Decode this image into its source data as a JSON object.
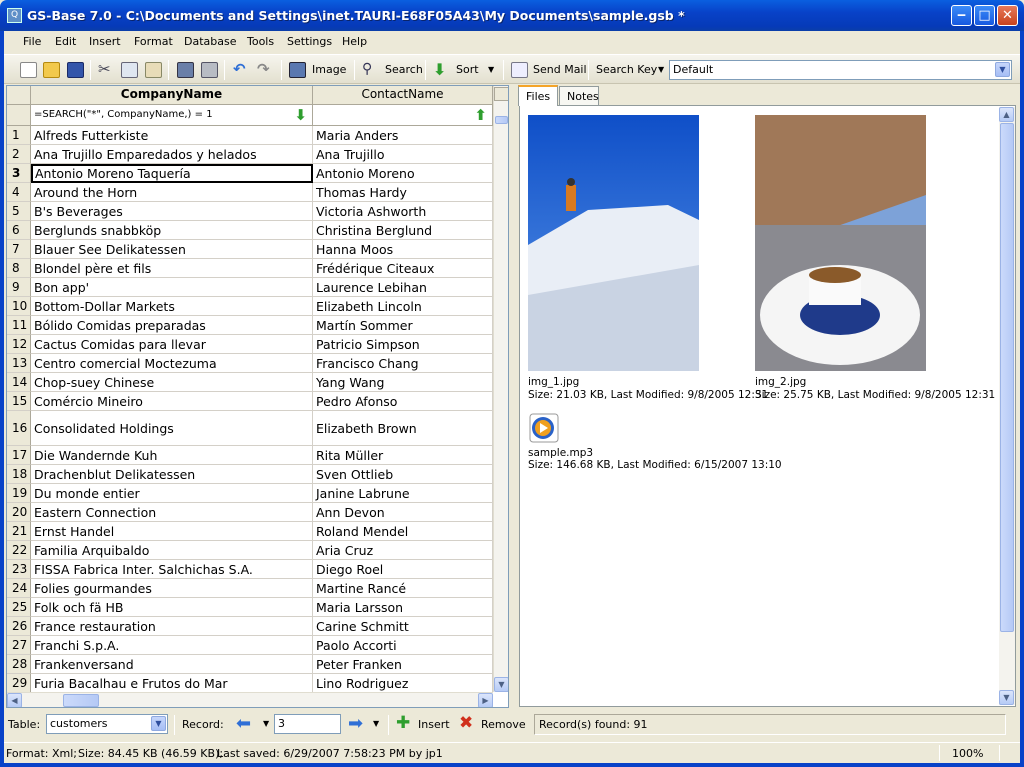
{
  "window": {
    "title": "GS-Base 7.0 - C:\\Documents and Settings\\inet.TAURI-E68F05A43\\My Documents\\sample.gsb *",
    "icon": "Q"
  },
  "menu": [
    "File",
    "Edit",
    "Insert",
    "Format",
    "Database",
    "Tools",
    "Settings",
    "Help"
  ],
  "toolbar": {
    "image_label": "Image",
    "search_label": "Search",
    "sort_label": "Sort",
    "sendmail_label": "Send Mail",
    "searchkey_label": "Search Key",
    "searchkey_value": "Default"
  },
  "grid": {
    "columns": [
      "CompanyName",
      "ContactName"
    ],
    "filter_formula": "=SEARCH(\"*\", CompanyName,) = 1",
    "selected_row": 3,
    "rows": [
      {
        "n": "1",
        "company": "Alfreds Futterkiste",
        "contact": "Maria Anders"
      },
      {
        "n": "2",
        "company": "Ana Trujillo Emparedados y helados",
        "contact": "Ana Trujillo"
      },
      {
        "n": "3",
        "company": "Antonio Moreno Taquería",
        "contact": "Antonio Moreno"
      },
      {
        "n": "4",
        "company": "Around the Horn",
        "contact": "Thomas Hardy"
      },
      {
        "n": "5",
        "company": "B's Beverages",
        "contact": "Victoria Ashworth"
      },
      {
        "n": "6",
        "company": "Berglunds snabbköp",
        "contact": "Christina Berglund"
      },
      {
        "n": "7",
        "company": "Blauer See Delikatessen",
        "contact": "Hanna Moos"
      },
      {
        "n": "8",
        "company": "Blondel père et fils",
        "contact": "Frédérique Citeaux"
      },
      {
        "n": "9",
        "company": "Bon app'",
        "contact": "Laurence Lebihan"
      },
      {
        "n": "10",
        "company": "Bottom-Dollar Markets",
        "contact": "Elizabeth Lincoln"
      },
      {
        "n": "11",
        "company": "Bólido Comidas preparadas",
        "contact": "Martín Sommer"
      },
      {
        "n": "12",
        "company": "Cactus Comidas para llevar",
        "contact": "Patricio Simpson"
      },
      {
        "n": "13",
        "company": "Centro comercial Moctezuma",
        "contact": "Francisco Chang"
      },
      {
        "n": "14",
        "company": "Chop-suey Chinese",
        "contact": "Yang Wang"
      },
      {
        "n": "15",
        "company": "Comércio Mineiro",
        "contact": "Pedro Afonso"
      },
      {
        "n": "16",
        "company": "Consolidated Holdings",
        "contact": "Elizabeth Brown"
      },
      {
        "n": "17",
        "company": "Die Wandernde Kuh",
        "contact": "Rita Müller"
      },
      {
        "n": "18",
        "company": "Drachenblut Delikatessen",
        "contact": "Sven Ottlieb"
      },
      {
        "n": "19",
        "company": "Du monde entier",
        "contact": "Janine Labrune"
      },
      {
        "n": "20",
        "company": "Eastern Connection",
        "contact": "Ann Devon"
      },
      {
        "n": "21",
        "company": "Ernst Handel",
        "contact": "Roland Mendel"
      },
      {
        "n": "22",
        "company": "Familia Arquibaldo",
        "contact": "Aria Cruz"
      },
      {
        "n": "23",
        "company": "FISSA Fabrica Inter. Salchichas S.A.",
        "contact": "Diego Roel"
      },
      {
        "n": "24",
        "company": "Folies gourmandes",
        "contact": "Martine Rancé"
      },
      {
        "n": "25",
        "company": "Folk och fä HB",
        "contact": "Maria Larsson"
      },
      {
        "n": "26",
        "company": "France restauration",
        "contact": "Carine Schmitt"
      },
      {
        "n": "27",
        "company": "Franchi S.p.A.",
        "contact": "Paolo Accorti"
      },
      {
        "n": "28",
        "company": "Frankenversand",
        "contact": "Peter Franken"
      },
      {
        "n": "29",
        "company": "Furia Bacalhau e Frutos do Mar",
        "contact": "Lino Rodriguez"
      }
    ]
  },
  "tabs": [
    "Files",
    "Notes"
  ],
  "files": [
    {
      "name": "img_1.jpg",
      "info": "Size: 21.03 KB, Last Modified: 9/8/2005 12:31"
    },
    {
      "name": "img_2.jpg",
      "info": "Size: 25.75 KB, Last Modified: 9/8/2005 12:31"
    },
    {
      "name": "sample.mp3",
      "info": "Size: 146.68 KB, Last Modified: 6/15/2007 13:10"
    }
  ],
  "bottom": {
    "table_label": "Table:",
    "table_value": "customers",
    "record_label": "Record:",
    "record_value": "3",
    "insert_label": "Insert",
    "remove_label": "Remove",
    "found": "Record(s) found: 91"
  },
  "status": {
    "format": "Format: Xml;",
    "size": "Size: 84.45 KB (46.59 KB);",
    "saved": "Last saved: 6/29/2007 7:58:23 PM by jp1",
    "zoom": "100%"
  }
}
